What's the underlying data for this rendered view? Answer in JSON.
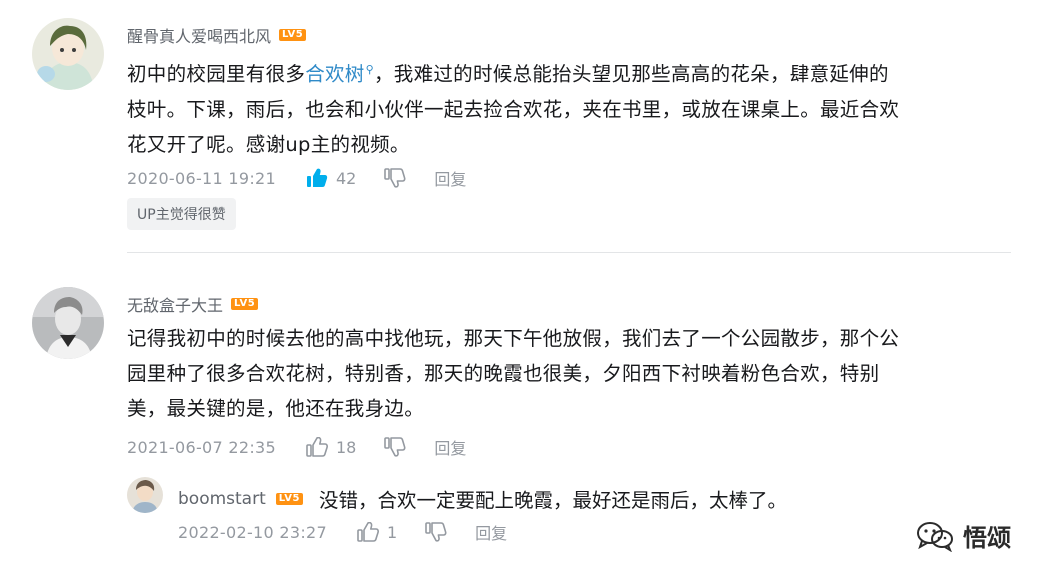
{
  "comments": [
    {
      "username": "醒骨真人爱喝西北风",
      "level": "LV5",
      "text_before_link": "初中的校园里有很多",
      "link_text": "合欢树",
      "text_after_link_line1": "，我难过的时候总能抬头望见那些高高的花朵，肆意延伸的",
      "text_line2": "枝叶。下课，雨后，也会和小伙伴一起去捡合欢花，夹在书里，或放在课桌上。最近合欢",
      "text_line3": "花又开了呢。感谢up主的视频。",
      "time": "2020-06-11 19:21",
      "likes": "42",
      "reply_label": "回复",
      "tag": "UP主觉得很赞"
    },
    {
      "username": "无敌盒子大王",
      "level": "LV5",
      "text_line1": "记得我初中的时候去他的高中找他玩，那天下午他放假，我们去了一个公园散步，那个公",
      "text_line2": "园里种了很多合欢花树，特别香，那天的晚霞也很美，夕阳西下衬映着粉色合欢，特别",
      "text_line3": "美，最关键的是，他还在我身边。",
      "time": "2021-06-07 22:35",
      "likes": "18",
      "reply_label": "回复"
    }
  ],
  "reply": {
    "username": "boomstart",
    "level": "LV5",
    "text": "没错，合欢一定要配上晚霞，最好还是雨后，太棒了。",
    "time": "2022-02-10 23:27",
    "likes": "1",
    "reply_label": "回复"
  },
  "watermark": {
    "text": "悟颂",
    "icon": "wechat-icon"
  },
  "colors": {
    "link": "#2f8ac8",
    "level_badge": "#ff9212",
    "liked": "#00aeec",
    "meta": "#9499a0"
  }
}
